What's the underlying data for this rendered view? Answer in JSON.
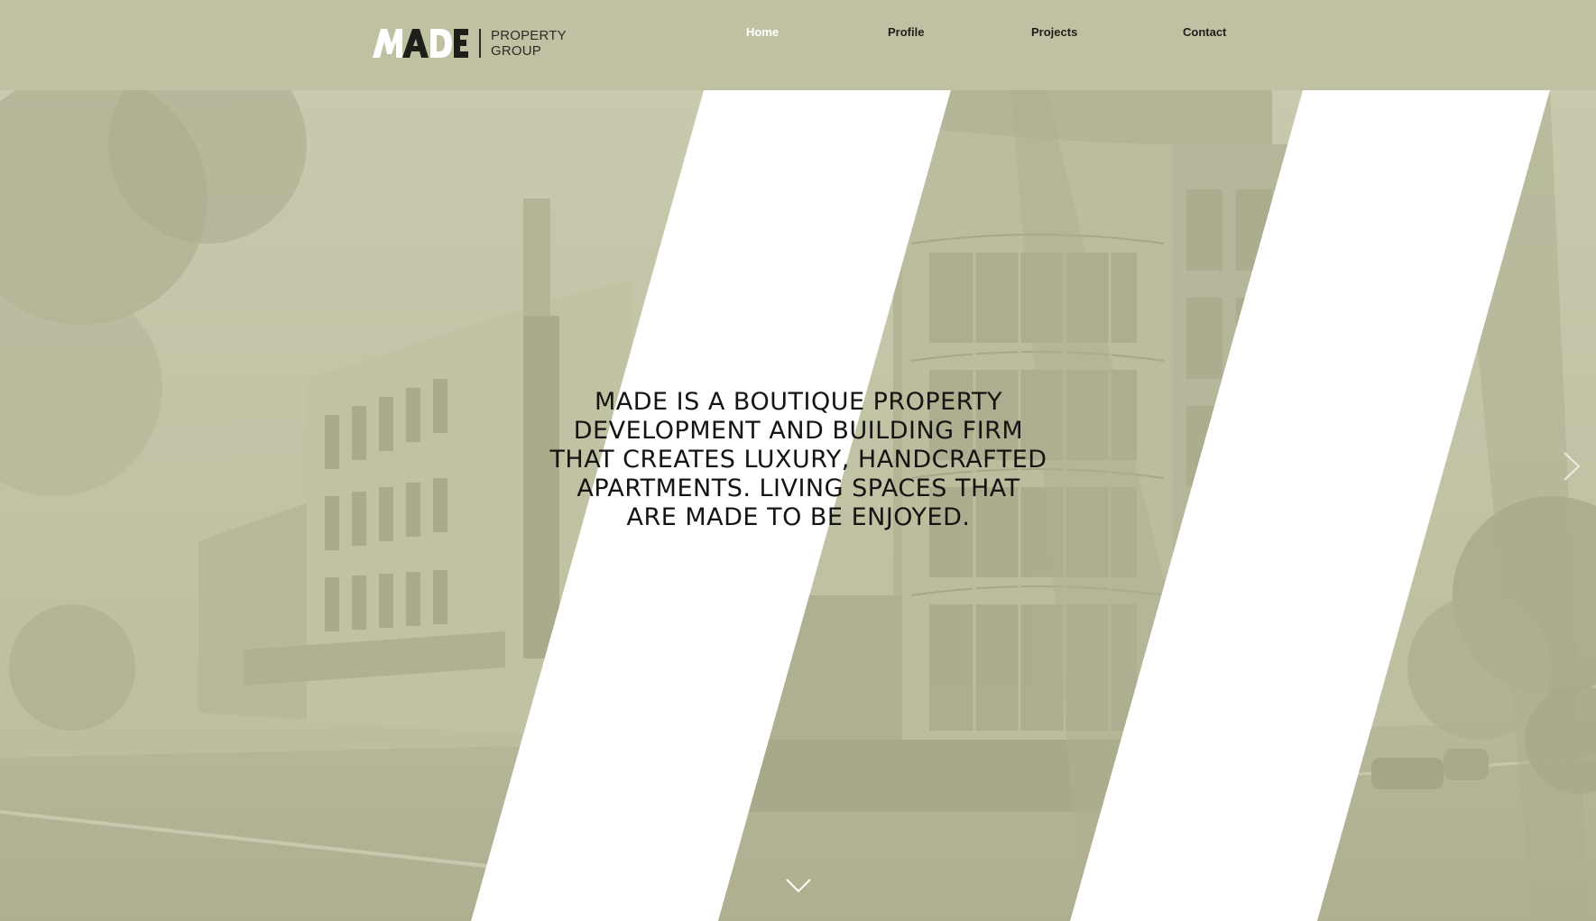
{
  "brand": {
    "logo_text": "MADE",
    "logo_subtitle_line1": "PROPERTY",
    "logo_subtitle_line2": "GROUP"
  },
  "nav": {
    "items": [
      {
        "label": "Home",
        "active": true
      },
      {
        "label": "Profile",
        "active": false
      },
      {
        "label": "Projects",
        "active": false
      },
      {
        "label": "Contact",
        "active": false
      }
    ]
  },
  "hero": {
    "headline_lines": [
      "MADE IS A BOUTIQUE PROPERTY",
      "DEVELOPMENT AND BUILDING FIRM",
      "THAT CREATES LUXURY, HANDCRAFTED",
      "APARTMENTS. LIVING SPACES THAT",
      "ARE MADE TO BE ENJOYED."
    ],
    "scroll_icon": "chevron-down-icon",
    "next_icon": "chevron-right-icon"
  },
  "colors": {
    "header_bg": "#c0c1a3",
    "overlay_tint": "#b9ba9b",
    "active_nav": "#ffffff",
    "text_dark": "#141411"
  }
}
